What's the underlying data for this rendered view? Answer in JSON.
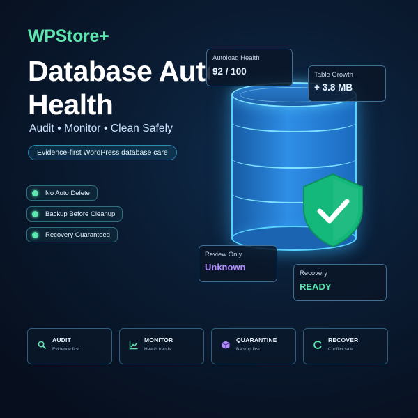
{
  "brand": "WPStore+",
  "hero": {
    "title": "Database Autoload\nHealth",
    "tagline": "Audit • Monitor • Clean Safely",
    "pill": "Evidence-first WordPress database care"
  },
  "features": [
    {
      "label": "No Auto Delete"
    },
    {
      "label": "Backup Before Cleanup"
    },
    {
      "label": "Recovery Guaranteed"
    }
  ],
  "cards": {
    "autoload": {
      "label": "Autoload Health",
      "value": "92 / 100"
    },
    "growth": {
      "label": "Table Growth",
      "value": "+ 3.8 MB"
    },
    "review": {
      "label": "Review Only",
      "value": "Unknown"
    },
    "recovery": {
      "label": "Recovery",
      "value": "READY"
    }
  },
  "tiles": [
    {
      "icon": "search-icon",
      "title": "AUDIT",
      "subtitle": "Evidence first"
    },
    {
      "icon": "trend-chart-icon",
      "title": "MONITOR",
      "subtitle": "Health trends"
    },
    {
      "icon": "box-icon",
      "title": "QUARANTINE",
      "subtitle": "Backup first"
    },
    {
      "icon": "recover-icon",
      "title": "RECOVER",
      "subtitle": "Conflict safe"
    }
  ],
  "colors": {
    "accent_green": "#5ee6b0",
    "database_blue": "#2f8ee6",
    "shield_green": "#14b87a",
    "review_purple": "#b38cff",
    "background": "#0a1c33"
  }
}
